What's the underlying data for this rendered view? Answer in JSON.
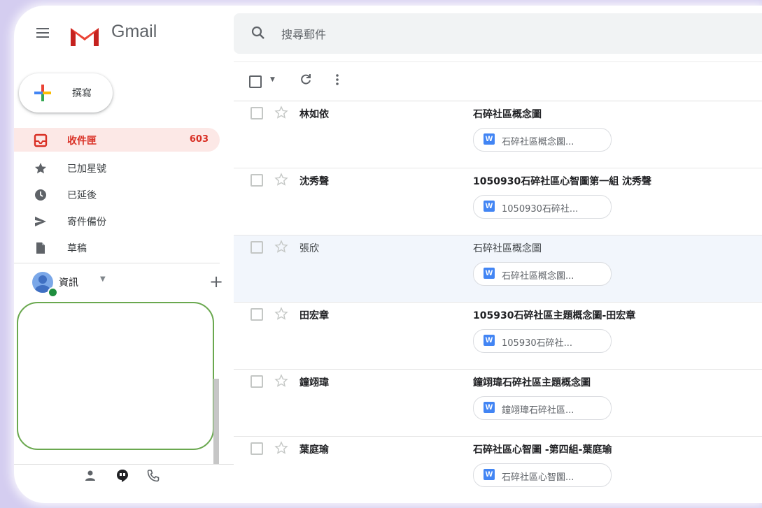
{
  "header": {
    "app_name": "Gmail",
    "search_placeholder": "搜尋郵件"
  },
  "compose": {
    "label": "撰寫"
  },
  "sidebar": {
    "items": [
      {
        "label": "收件匣",
        "icon": "inbox-icon",
        "count": "603",
        "active": true
      },
      {
        "label": "已加星號",
        "icon": "star-icon"
      },
      {
        "label": "已延後",
        "icon": "clock-icon"
      },
      {
        "label": "寄件備份",
        "icon": "send-icon"
      },
      {
        "label": "草稿",
        "icon": "draft-icon"
      }
    ]
  },
  "account": {
    "name": "資訊"
  },
  "emails": [
    {
      "sender": "林如依",
      "subject": "石碎社區概念圖",
      "attachment": "石碎社區概念圖...",
      "read": false
    },
    {
      "sender": "沈秀聲",
      "subject": "1050930石碎社區心智圖第一組 沈秀聲",
      "attachment": "1050930石碎社...",
      "read": false
    },
    {
      "sender": "張欣",
      "subject": "石碎社區概念圖",
      "attachment": "石碎社區概念圖...",
      "read": true
    },
    {
      "sender": "田宏章",
      "subject": "105930石碎社區主題概念圖-田宏章",
      "attachment": "105930石碎社...",
      "read": false
    },
    {
      "sender": "鐘翊瑋",
      "subject": "鐘翊瑋石碎社區主題概念圖",
      "attachment": "鐘翊瑋石碎社區...",
      "read": false
    },
    {
      "sender": "葉庭瑜",
      "subject": "石碎社區心智圖 -第四組-葉庭瑜",
      "attachment": "石碎社區心智圖...",
      "read": false
    }
  ],
  "attachment_icon_letter": "W",
  "colors": {
    "background": "#d4cdf0",
    "inbox_active_bg": "#fce8e6",
    "inbox_active_text": "#d93025",
    "word_icon": "#4285f4",
    "hangouts_border": "#6aa84f"
  }
}
